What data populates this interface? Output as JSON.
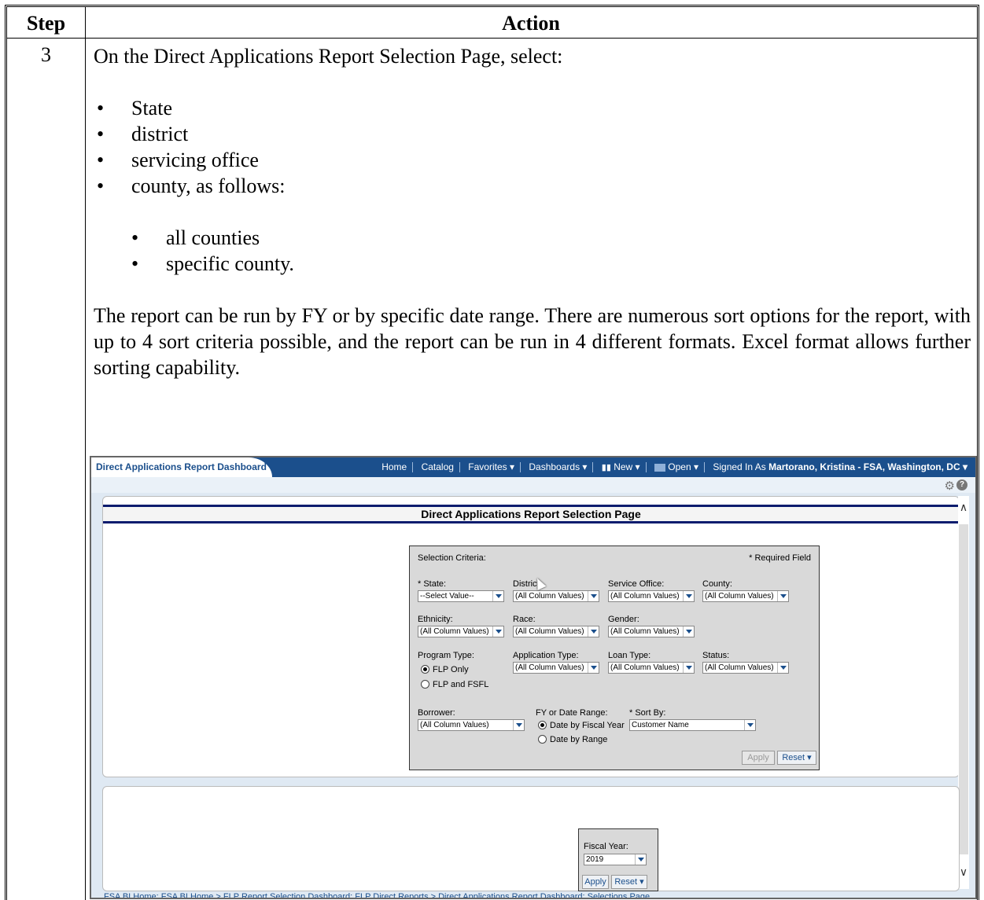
{
  "table": {
    "col_step": "Step",
    "col_action": "Action",
    "step_number": "3",
    "intro": "On the Direct Applications Report Selection Page, select:",
    "bullets": [
      "State",
      "district",
      "servicing office",
      "county, as follows:"
    ],
    "sub_bullets": [
      "all counties",
      "specific county."
    ],
    "paragraph": "The report can be run by FY or by specific date range.  There are numerous sort options for the report, with up to 4 sort criteria possible, and the report can be run in 4 different formats.  Excel format allows further sorting capability."
  },
  "screenshot": {
    "tab_title": "Direct Applications Report Dashboard",
    "nav": {
      "home": "Home",
      "catalog": "Catalog",
      "favorites": "Favorites ▾",
      "dashboards": "Dashboards ▾",
      "new": "New ▾",
      "open": "Open ▾",
      "signed_in_prefix": "Signed In As",
      "signed_in_user": "Martorano, Kristina - FSA, Washington, DC ▾"
    },
    "panel_title": "Direct Applications Report Selection Page",
    "criteria": {
      "heading": "Selection Criteria:",
      "required_note": "* Required Field",
      "state_label": "* State:",
      "state_value": "--Select Value--",
      "district_label": "District:",
      "district_value": "(All Column Values)",
      "service_office_label": "Service Office:",
      "service_office_value": "(All Column Values)",
      "county_label": "County:",
      "county_value": "(All Column Values)",
      "ethnicity_label": "Ethnicity:",
      "ethnicity_value": "(All Column Values)",
      "race_label": "Race:",
      "race_value": "(All Column Values)",
      "gender_label": "Gender:",
      "gender_value": "(All Column Values)",
      "program_type_label": "Program Type:",
      "program_opt1": "FLP Only",
      "program_opt2": "FLP and FSFL",
      "application_type_label": "Application Type:",
      "application_type_value": "(All Column Values)",
      "loan_type_label": "Loan Type:",
      "loan_type_value": "(All Column Values)",
      "status_label": "Status:",
      "status_value": "(All Column Values)",
      "borrower_label": "Borrower:",
      "borrower_value": "(All Column Values)",
      "fy_range_label": "FY or Date Range:",
      "fy_opt1": "Date by Fiscal Year",
      "fy_opt2": "Date by Range",
      "sort_label": "* Sort By:",
      "sort_value": "Customer Name",
      "apply": "Apply",
      "reset": "Reset ▾"
    },
    "fiscal": {
      "label": "Fiscal Year:",
      "value": "2019",
      "apply": "Apply",
      "reset": "Reset ▾"
    },
    "breadcrumb": "FSA BI Home: FSA BI Home  >  FLP Report Selection Dashboard: FLP Direct Reports  >  Direct Applications Report Dashboard: Selections Page"
  }
}
